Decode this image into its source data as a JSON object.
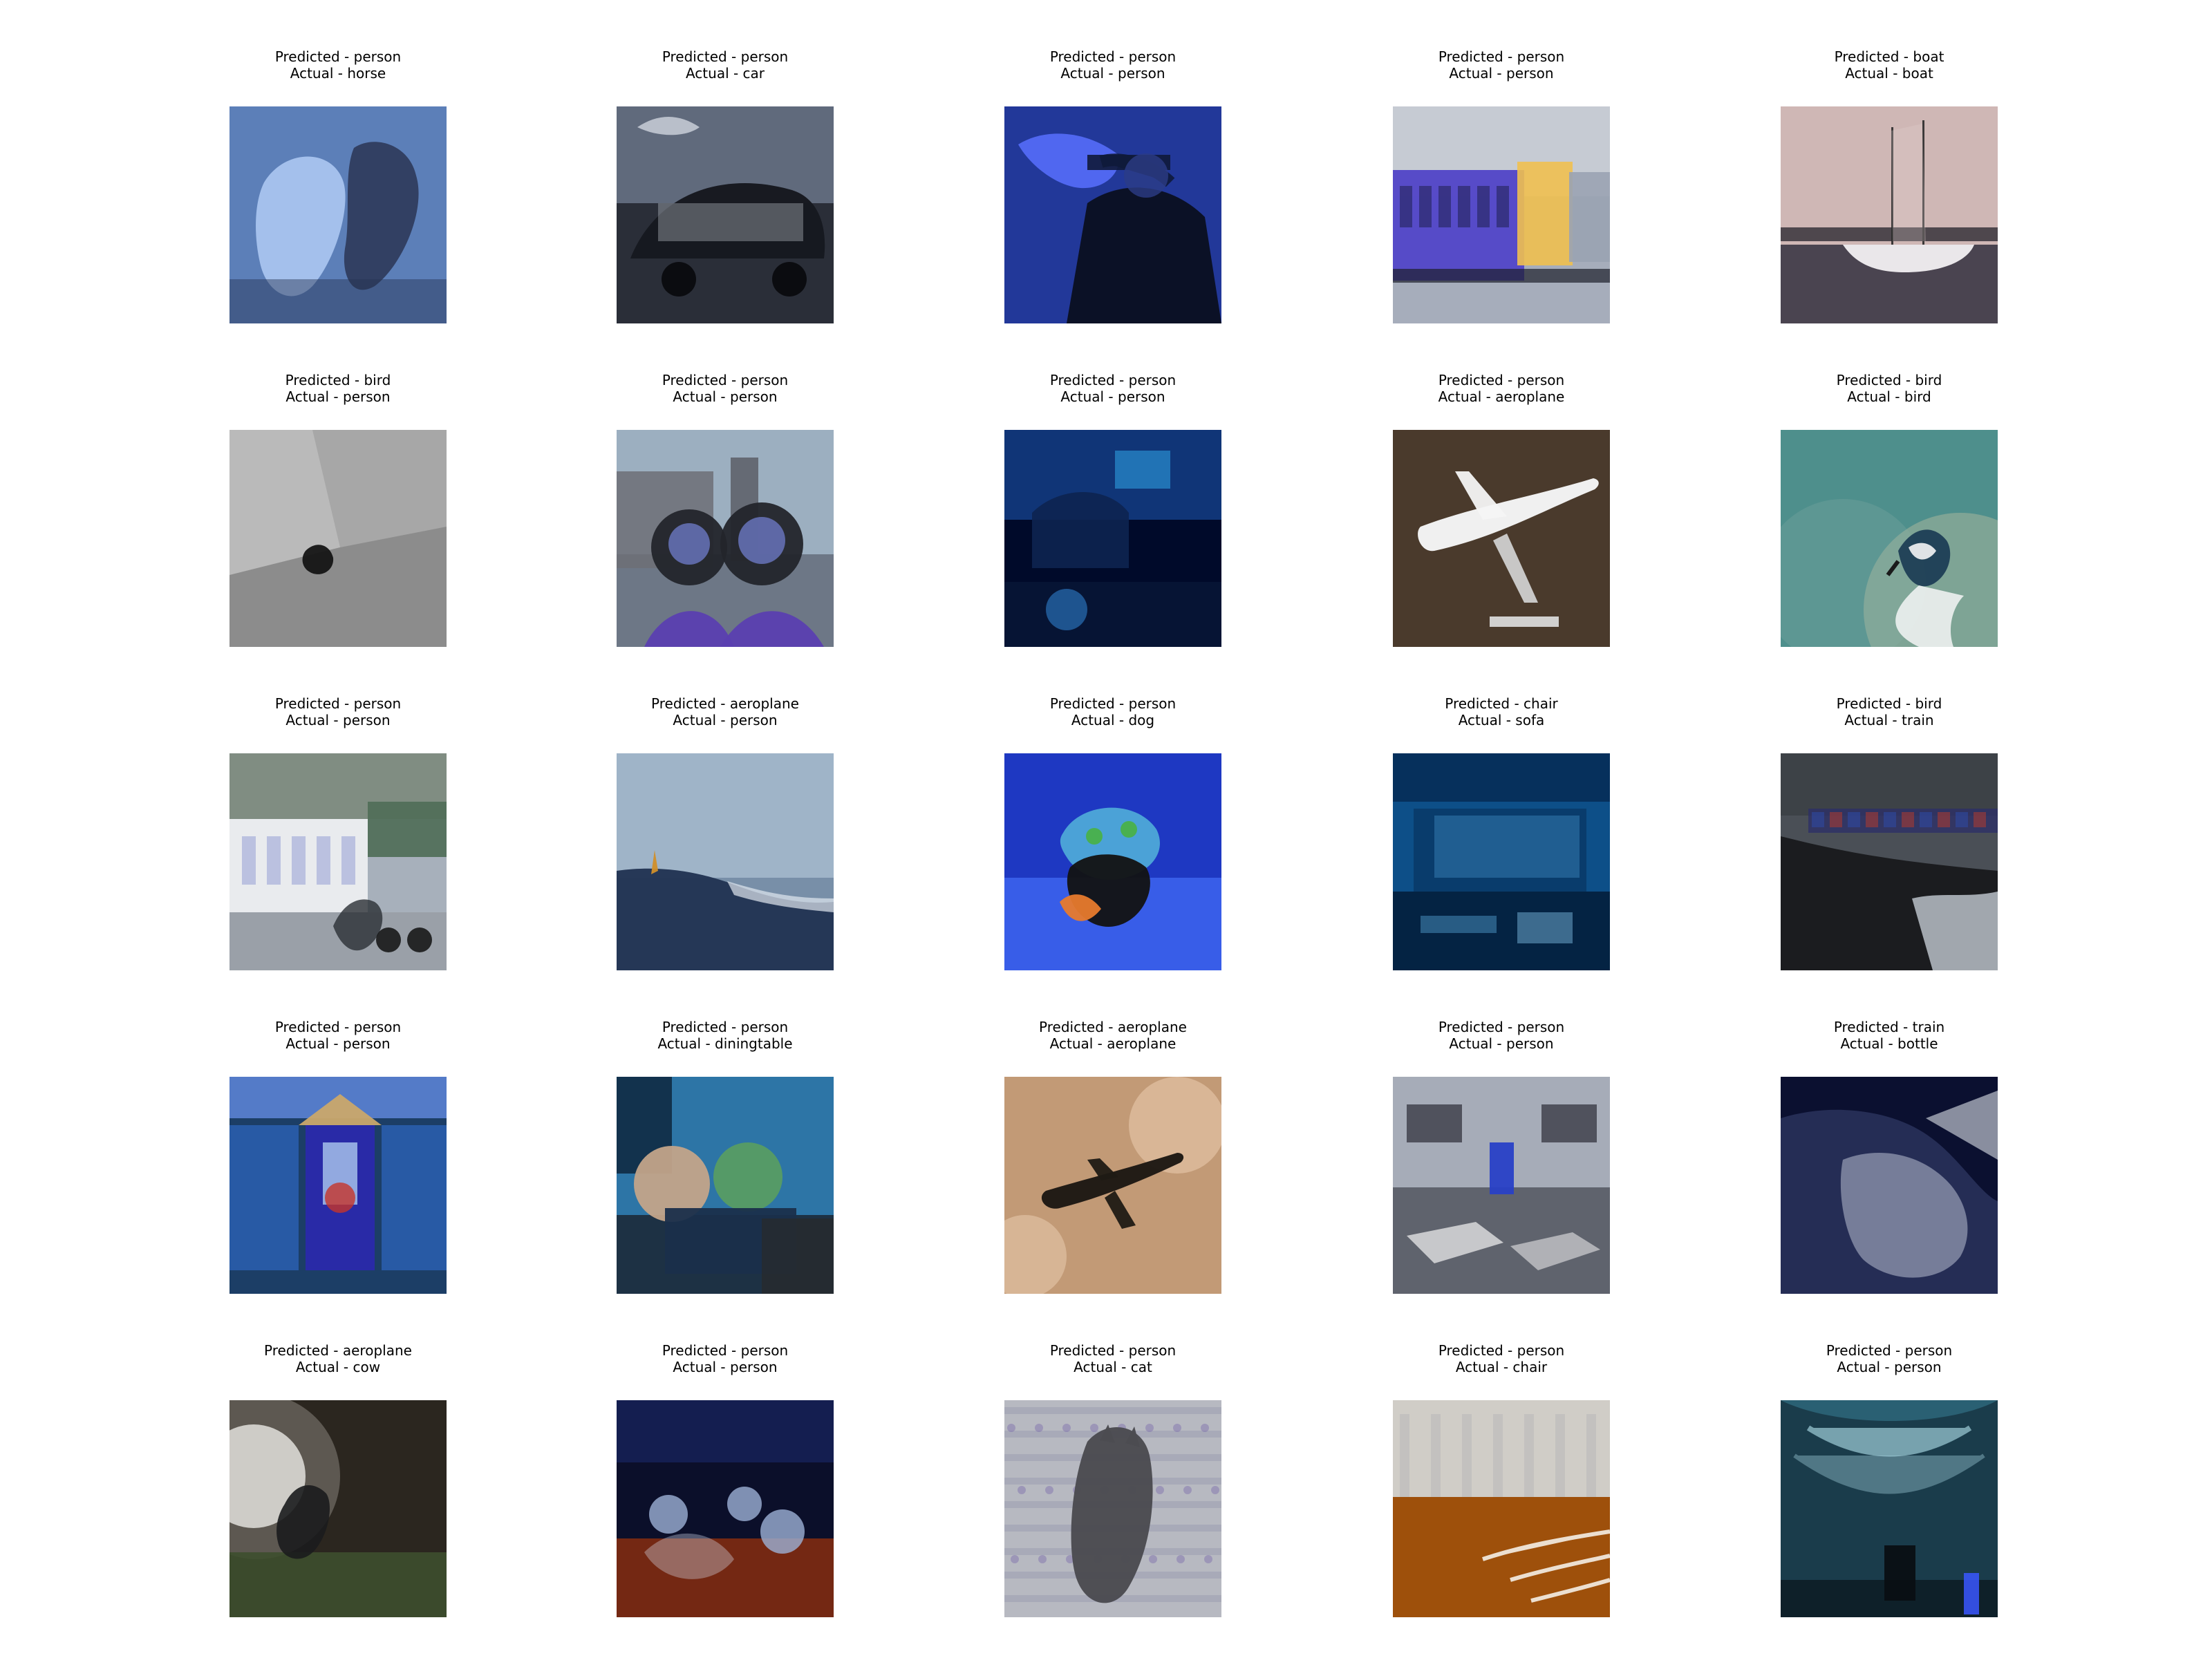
{
  "panels": [
    {
      "predicted": "Predicted - person",
      "actual": "Actual - horse",
      "scene": "horses",
      "palette": [
        "#5c7fb8",
        "#a8c4ee",
        "#2f3d5e"
      ]
    },
    {
      "predicted": "Predicted - person",
      "actual": "Actual - car",
      "scene": "car",
      "palette": [
        "#606a7c",
        "#161820",
        "#c9ced8"
      ]
    },
    {
      "predicted": "Predicted - person",
      "actual": "Actual - person",
      "scene": "trumpet",
      "palette": [
        "#2f4fcc",
        "#0b1024",
        "#5870ff"
      ]
    },
    {
      "predicted": "Predicted - person",
      "actual": "Actual - person",
      "scene": "train",
      "palette": [
        "#c6cbd3",
        "#5548c8",
        "#f0c050"
      ]
    },
    {
      "predicted": "Predicted - boat",
      "actual": "Actual - boat",
      "scene": "boat",
      "palette": [
        "#cfb7b5",
        "#6d6370",
        "#f2f0f2"
      ]
    },
    {
      "predicted": "Predicted - bird",
      "actual": "Actual - person",
      "scene": "room-gray",
      "palette": [
        "#a7a7a7",
        "#5d5d5d",
        "#151515"
      ]
    },
    {
      "predicted": "Predicted - person",
      "actual": "Actual - person",
      "scene": "selfie",
      "palette": [
        "#9cafc0",
        "#2c2f37",
        "#5b3fb0"
      ]
    },
    {
      "predicted": "Predicted - person",
      "actual": "Actual - person",
      "scene": "lounge",
      "palette": [
        "#123a80",
        "#000a2a",
        "#2a8fd0"
      ]
    },
    {
      "predicted": "Predicted - person",
      "actual": "Actual - aeroplane",
      "scene": "model-plane",
      "palette": [
        "#4a3a2c",
        "#f4f4f4",
        "#2b2118"
      ]
    },
    {
      "predicted": "Predicted - bird",
      "actual": "Actual - bird",
      "scene": "kingfisher",
      "palette": [
        "#4e8f8c",
        "#d9caa6",
        "#1d3e55"
      ]
    },
    {
      "predicted": "Predicted - person",
      "actual": "Actual - person",
      "scene": "street",
      "palette": [
        "#a7b0bb",
        "#4f6d56",
        "#1e2440"
      ]
    },
    {
      "predicted": "Predicted - aeroplane",
      "actual": "Actual - person",
      "scene": "rocks-sea",
      "palette": [
        "#9fb4c8",
        "#243555",
        "#dfe7ef"
      ]
    },
    {
      "predicted": "Predicted - person",
      "actual": "Actual - dog",
      "scene": "dog-costume",
      "palette": [
        "#1e38c2",
        "#3a5fea",
        "#e77a2d"
      ]
    },
    {
      "predicted": "Predicted - chair",
      "actual": "Actual - sofa",
      "scene": "blue-room",
      "palette": [
        "#0d4f88",
        "#062a55",
        "#67c2ff"
      ]
    },
    {
      "predicted": "Predicted - bird",
      "actual": "Actual - train",
      "scene": "coast-train",
      "palette": [
        "#4a4f56",
        "#1b1c1e",
        "#cfd6df"
      ]
    },
    {
      "predicted": "Predicted - person",
      "actual": "Actual - person",
      "scene": "kiosk",
      "palette": [
        "#2a2aa8",
        "#5e86d9",
        "#caa86b"
      ]
    },
    {
      "predicted": "Predicted - person",
      "actual": "Actual - diningtable",
      "scene": "restaurant",
      "palette": [
        "#2d75a6",
        "#c3a489",
        "#0e1b2a"
      ]
    },
    {
      "predicted": "Predicted - aeroplane",
      "actual": "Actual - aeroplane",
      "scene": "plane-sky",
      "palette": [
        "#c29a76",
        "#f0d2b5",
        "#1f1a14"
      ]
    },
    {
      "predicted": "Predicted - person",
      "actual": "Actual - person",
      "scene": "storefront",
      "palette": [
        "#767a86",
        "#2c2e38",
        "#2840c6"
      ]
    },
    {
      "predicted": "Predicted - train",
      "actual": "Actual - bottle",
      "scene": "dark-blue",
      "palette": [
        "#0b1030",
        "#d9e1ee",
        "#2c345f"
      ]
    },
    {
      "predicted": "Predicted - aeroplane",
      "actual": "Actual - cow",
      "scene": "night-glow",
      "palette": [
        "#2b261f",
        "#f5f4f2",
        "#3d4f2e"
      ]
    },
    {
      "predicted": "Predicted - person",
      "actual": "Actual - person",
      "scene": "crowd-red",
      "palette": [
        "#0b0f2a",
        "#7a2a12",
        "#9cb0d6"
      ]
    },
    {
      "predicted": "Predicted - person",
      "actual": "Actual - cat",
      "scene": "cat",
      "palette": [
        "#b7b9c1",
        "#4c4c52",
        "#6b56a6"
      ]
    },
    {
      "predicted": "Predicted - person",
      "actual": "Actual - chair",
      "scene": "deck",
      "palette": [
        "#a1520b",
        "#f2efe8",
        "#2a1b10"
      ]
    },
    {
      "predicted": "Predicted - person",
      "actual": "Actual - person",
      "scene": "tunnel",
      "palette": [
        "#2a6073",
        "#0d1f2a",
        "#b6e6f1"
      ]
    }
  ]
}
